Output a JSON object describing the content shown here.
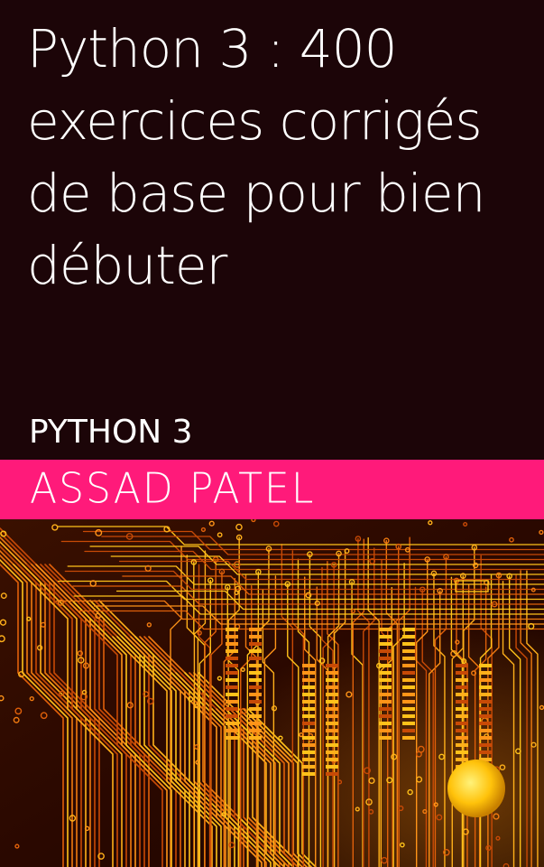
{
  "book": {
    "title": "Python 3 : 400 exercices corrigés de base pour bien débuter",
    "series": "PYTHON 3",
    "author": "ASSAD PATEL"
  },
  "colors": {
    "background": "#1c0508",
    "author_band": "#ff1a7a",
    "circuit_orange": "#f07a10",
    "circuit_yellow": "#ffc21a"
  },
  "artwork": {
    "icon": "circuit-board-icon"
  }
}
